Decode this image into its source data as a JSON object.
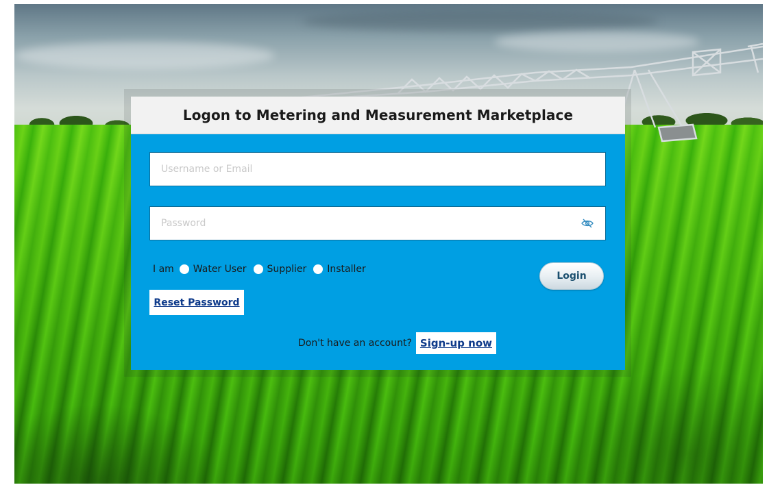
{
  "login": {
    "title": "Logon to Metering and Measurement Marketplace",
    "username_placeholder": "Username or Email",
    "password_placeholder": "Password",
    "role_prefix": "I am",
    "roles": [
      "Water User",
      "Supplier",
      "Installer"
    ],
    "login_button": "Login",
    "reset_password": "Reset Password",
    "signup_question": "Don't have an account?",
    "signup_link": "Sign-up now"
  },
  "icons": {
    "password_toggle": "eye-slash-icon"
  },
  "colors": {
    "card_background": "#009fe3",
    "header_background": "#f2f2f2",
    "link_color": "#0e3a8a"
  }
}
